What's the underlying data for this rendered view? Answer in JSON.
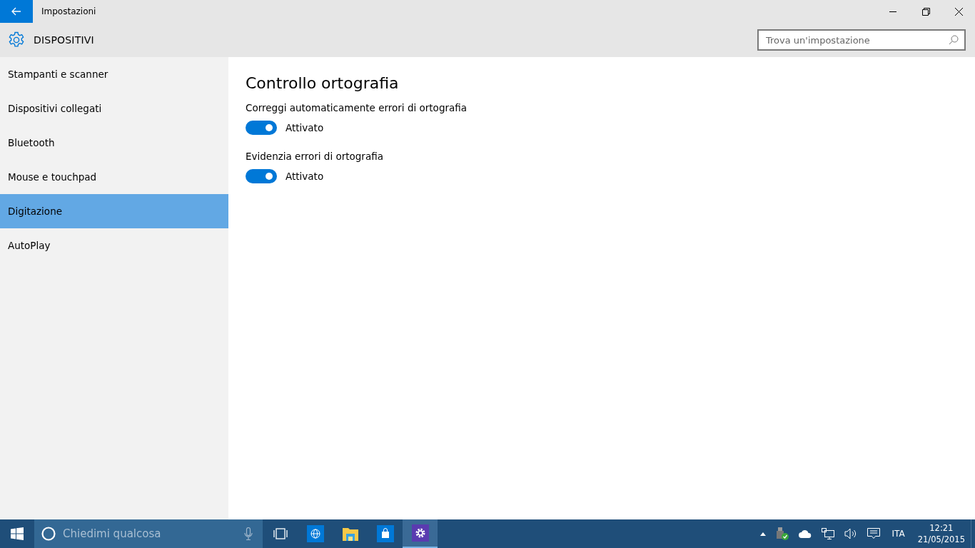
{
  "window": {
    "title": "Impostazioni"
  },
  "header": {
    "section": "DISPOSITIVI",
    "search": {
      "placeholder": "Trova un'impostazione"
    }
  },
  "sidebar": {
    "items": [
      {
        "label": "Stampanti e scanner",
        "selected": false
      },
      {
        "label": "Dispositivi collegati",
        "selected": false
      },
      {
        "label": "Bluetooth",
        "selected": false
      },
      {
        "label": "Mouse e touchpad",
        "selected": false
      },
      {
        "label": "Digitazione",
        "selected": true
      },
      {
        "label": "AutoPlay",
        "selected": false
      }
    ]
  },
  "content": {
    "title": "Controllo ortografia",
    "settings": [
      {
        "label": "Correggi automaticamente errori di ortografia",
        "on": true,
        "state": "Attivato"
      },
      {
        "label": "Evidenzia errori di ortografia",
        "on": true,
        "state": "Attivato"
      }
    ]
  },
  "taskbar": {
    "search": {
      "placeholder": "Chiedimi qualcosa"
    },
    "apps": [
      {
        "selected": false
      },
      {
        "selected": false
      },
      {
        "selected": false
      },
      {
        "selected": false
      },
      {
        "selected": true
      }
    ],
    "language": "ITA",
    "time": "12:21",
    "date": "21/05/2015"
  }
}
